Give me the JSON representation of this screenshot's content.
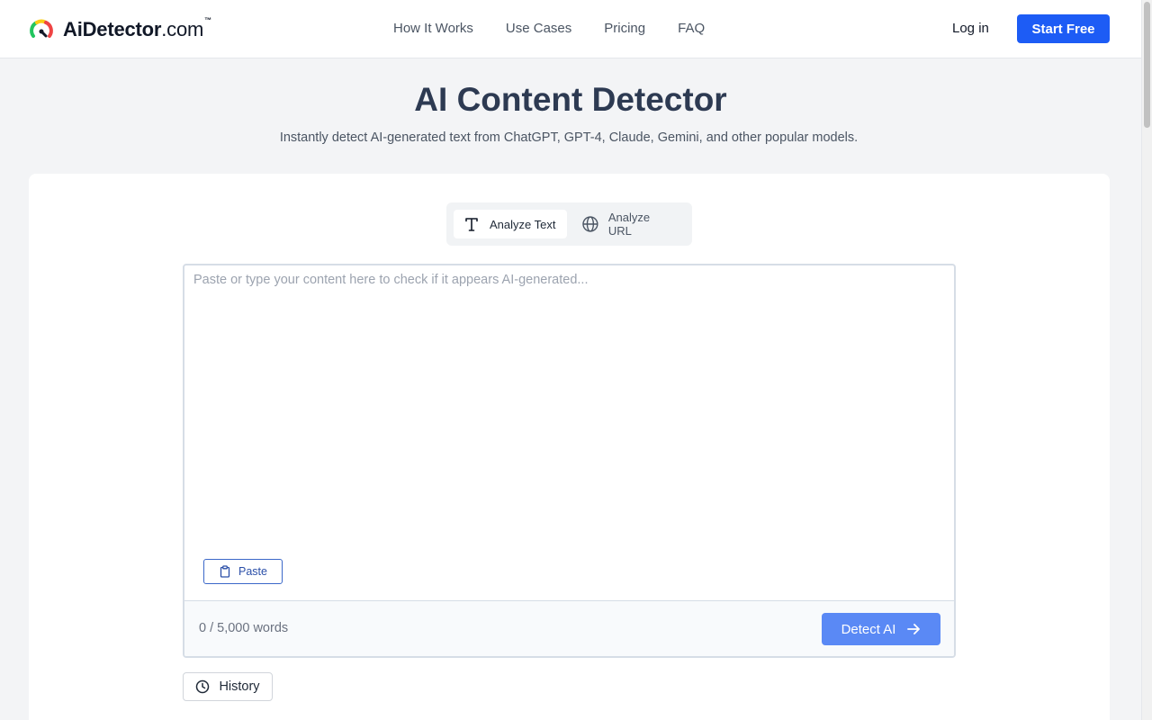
{
  "header": {
    "logo_brand": "AiDetector",
    "logo_tld": ".com",
    "logo_tm": "™",
    "nav": [
      "How It Works",
      "Use Cases",
      "Pricing",
      "FAQ"
    ],
    "login_label": "Log in",
    "start_label": "Start Free"
  },
  "hero": {
    "title": "AI Content Detector",
    "subtitle": "Instantly detect AI-generated text from ChatGPT, GPT-4, Claude, Gemini, and other popular models."
  },
  "tabs": {
    "text_label": "Analyze Text",
    "url_label": "Analyze URL",
    "active": "Analyze Text"
  },
  "editor": {
    "placeholder": "Paste or type your content here to check if it appears AI-generated...",
    "value": "",
    "paste_label": "Paste",
    "word_count": "0 / 5,000 words",
    "detect_label": "Detect AI"
  },
  "history_label": "History",
  "colors": {
    "primary": "#1d5cf5",
    "detect_button": "#5a89f5",
    "title": "#2d3a52",
    "background": "#f3f4f6"
  },
  "icons": {
    "logo": "gauge-logo-icon",
    "text_tab": "type-icon",
    "url_tab": "globe-icon",
    "paste": "clipboard-icon",
    "detect": "arrow-right-icon",
    "history": "clock-icon"
  }
}
